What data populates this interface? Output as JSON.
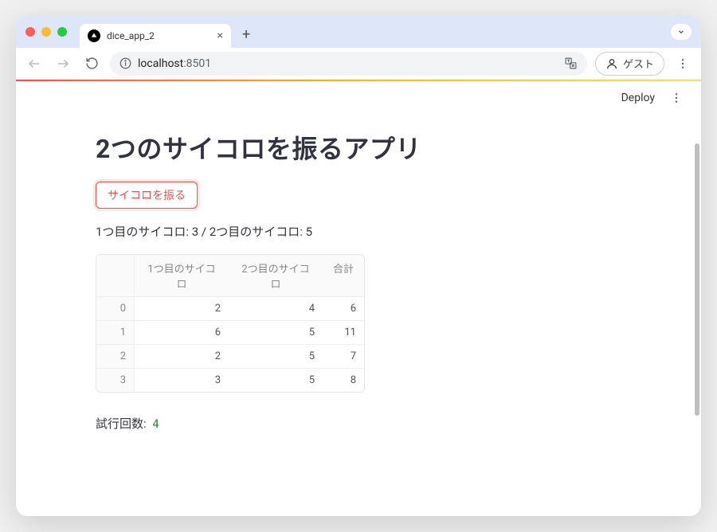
{
  "browser": {
    "tab_title": "dice_app_2",
    "url_host": "localhost",
    "url_port": ":8501",
    "guest_label": "ゲスト"
  },
  "toolbar": {
    "deploy_label": "Deploy"
  },
  "app": {
    "title": "2つのサイコロを振るアプリ",
    "button_label": "サイコロを振る",
    "result_text": "1つ目のサイコロ: 3 / 2つ目のサイコロ: 5",
    "trial_label": "試行回数:",
    "trial_count": "4"
  },
  "table": {
    "columns": [
      "1つ目のサイコロ",
      "2つ目のサイコロ",
      "合計"
    ],
    "rows": [
      {
        "idx": "0",
        "c1": "2",
        "c2": "4",
        "c3": "6"
      },
      {
        "idx": "1",
        "c1": "6",
        "c2": "5",
        "c3": "11"
      },
      {
        "idx": "2",
        "c1": "2",
        "c2": "5",
        "c3": "7"
      },
      {
        "idx": "3",
        "c1": "3",
        "c2": "5",
        "c3": "8"
      }
    ]
  }
}
